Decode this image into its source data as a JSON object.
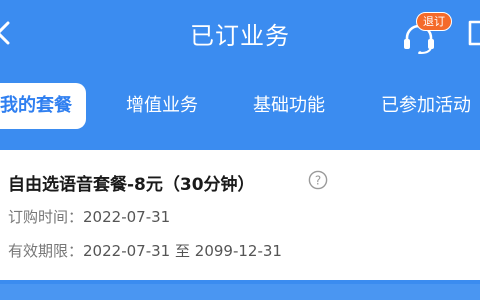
{
  "header": {
    "title": "已订业务",
    "unsubscribe_badge": "退订",
    "icons": [
      "back-arrow-icon",
      "headset-icon",
      "share-icon"
    ]
  },
  "tabs": [
    {
      "label": "我的套餐",
      "active": true
    },
    {
      "label": "增值业务",
      "active": false
    },
    {
      "label": "基础功能",
      "active": false
    },
    {
      "label": "已参加活动",
      "active": false
    }
  ],
  "plan": {
    "name": "自由选语音套餐-8元（30分钟）",
    "order_time_label": "订购时间：",
    "order_time": "2022-07-31",
    "validity_label": "有效期限：",
    "validity_start": "2022-07-31",
    "validity_sep": "至",
    "validity_end": "2099-12-31"
  },
  "colors": {
    "brand_blue": "#3b8cf0",
    "badge_orange": "#f46a2a",
    "active_tab_text": "#2f7ff0"
  }
}
